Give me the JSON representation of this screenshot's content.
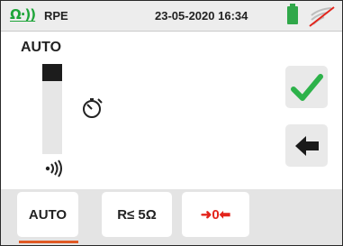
{
  "header": {
    "function_symbol": "Ω·))",
    "mode": "RPE",
    "datetime": "23-05-2020 16:34",
    "battery_icon": "battery-full-icon",
    "remote_icon": "remote-disconnected-icon"
  },
  "main": {
    "scale_mode": "AUTO",
    "scale_marker_icon": "range-marker-icon",
    "timer_icon": "timer-icon",
    "buzzer_icon": "buzzer-icon",
    "ok_button_icon": "check-icon",
    "back_button_icon": "arrow-left-icon"
  },
  "bottom_bar": {
    "tabs": [
      {
        "label": "AUTO",
        "selected": true
      },
      {
        "label": "R≤ 5Ω",
        "selected": false
      },
      {
        "label": "➜0⬅",
        "selected": false
      }
    ]
  },
  "colors": {
    "accent_green": "#1fa53a",
    "battery_green": "#30a84a",
    "selected_underline": "#e05a25",
    "null_red": "#e3241b",
    "header_bg": "#ededed",
    "bar_bg": "#e4e4e4"
  }
}
